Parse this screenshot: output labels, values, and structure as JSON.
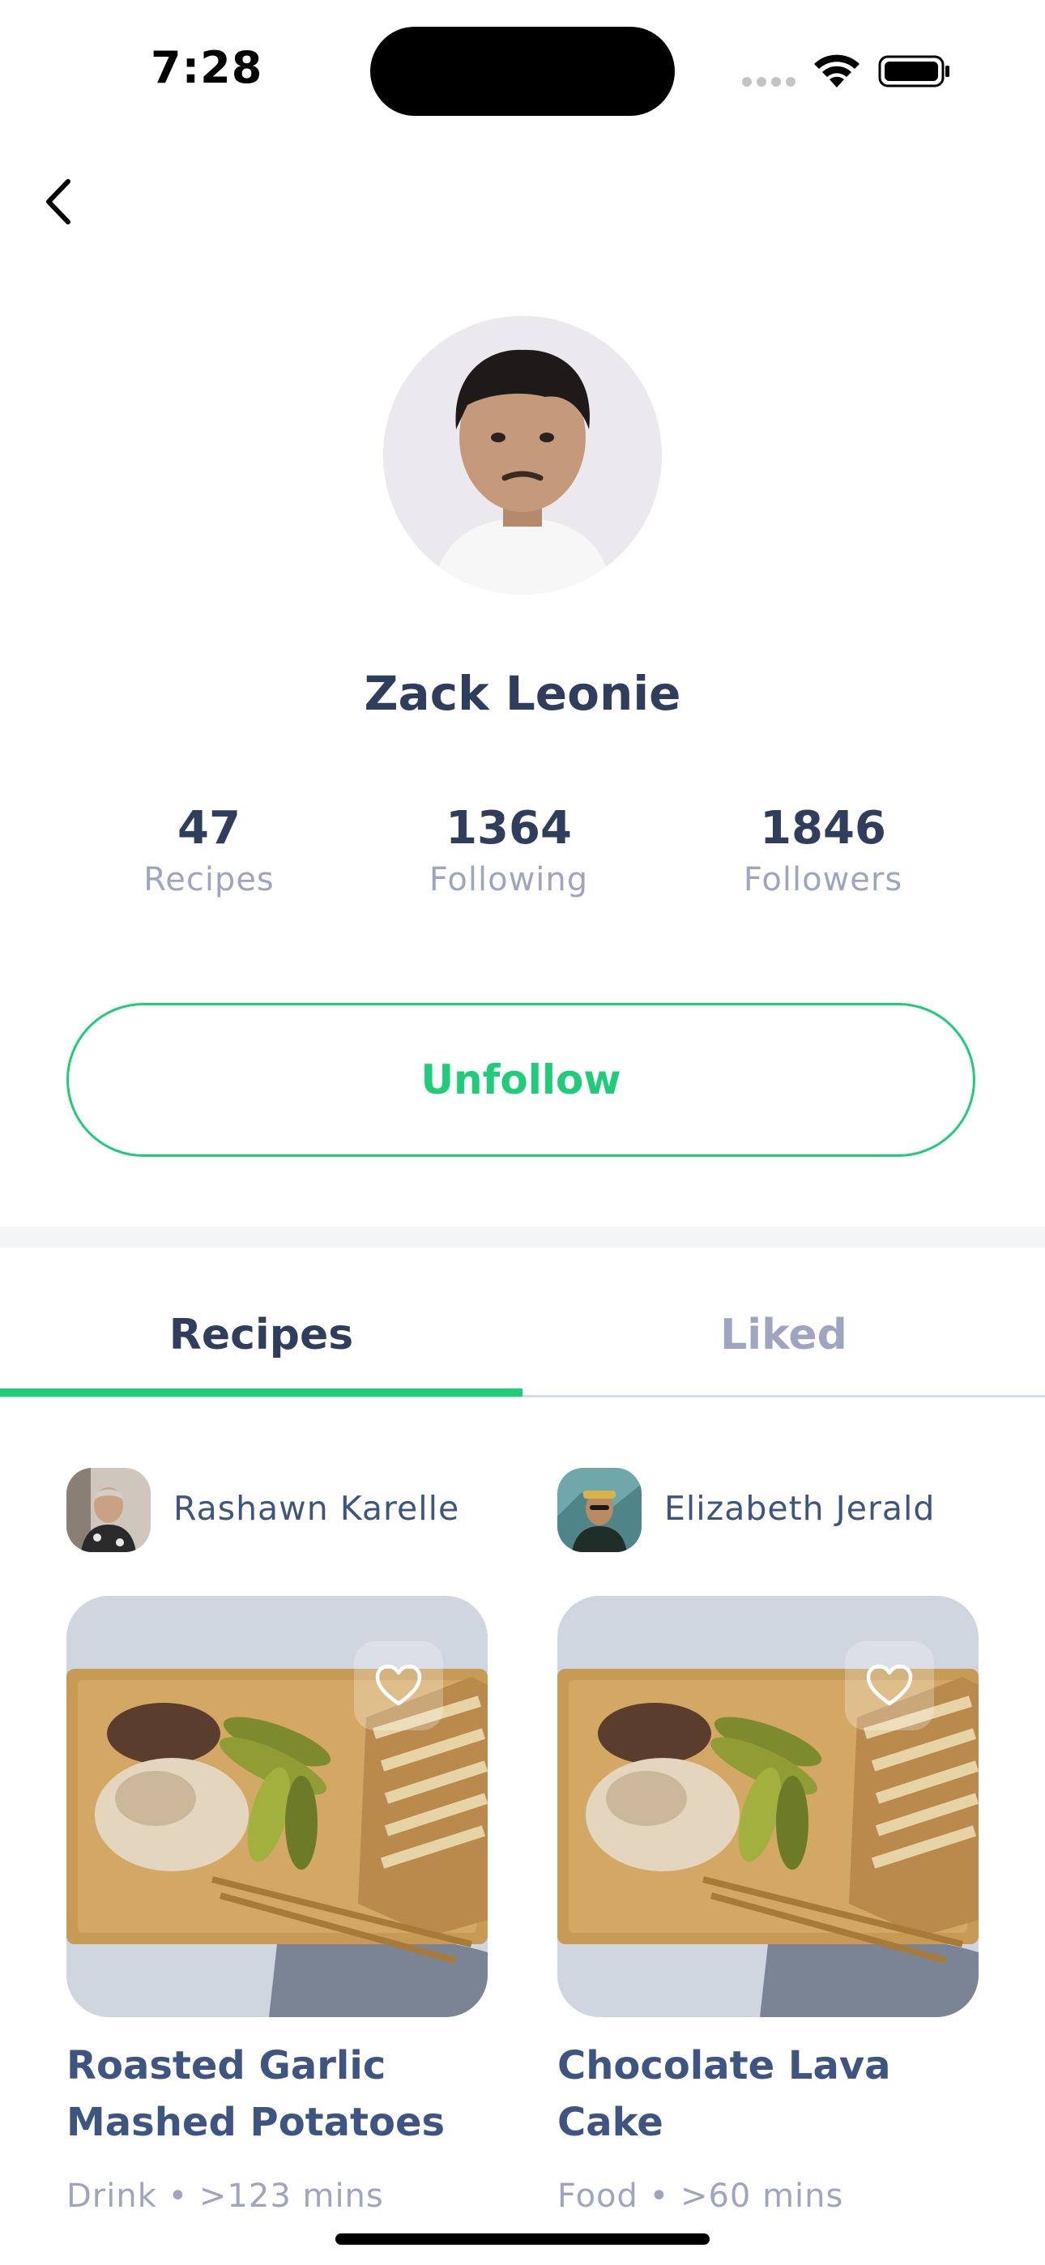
{
  "status_bar": {
    "time": "7:28"
  },
  "profile": {
    "name": "Zack Leonie",
    "stats": [
      {
        "value": "47",
        "label": "Recipes"
      },
      {
        "value": "1364",
        "label": "Following"
      },
      {
        "value": "1846",
        "label": "Followers"
      }
    ],
    "unfollow_label": "Unfollow"
  },
  "tabs": [
    {
      "label": "Recipes",
      "active": true
    },
    {
      "label": "Liked",
      "active": false
    }
  ],
  "recipes": [
    {
      "author": "Rashawn Karelle",
      "title_line1": "Roasted Garlic",
      "title_line2": "Mashed Potatoes",
      "meta": "Drink • >123 mins"
    },
    {
      "author": "Elizabeth Jerald",
      "title_line1": "Chocolate Lava",
      "title_line2": "Cake",
      "meta": "Food • >60 mins"
    }
  ],
  "colors": {
    "primary": "#1FCC79",
    "heading": "#2E3E5C",
    "secondary_text": "#9FA5C0",
    "card_text": "#3E5481"
  },
  "icons": [
    "back-arrow-icon",
    "wifi-icon",
    "battery-icon",
    "heart-icon"
  ]
}
